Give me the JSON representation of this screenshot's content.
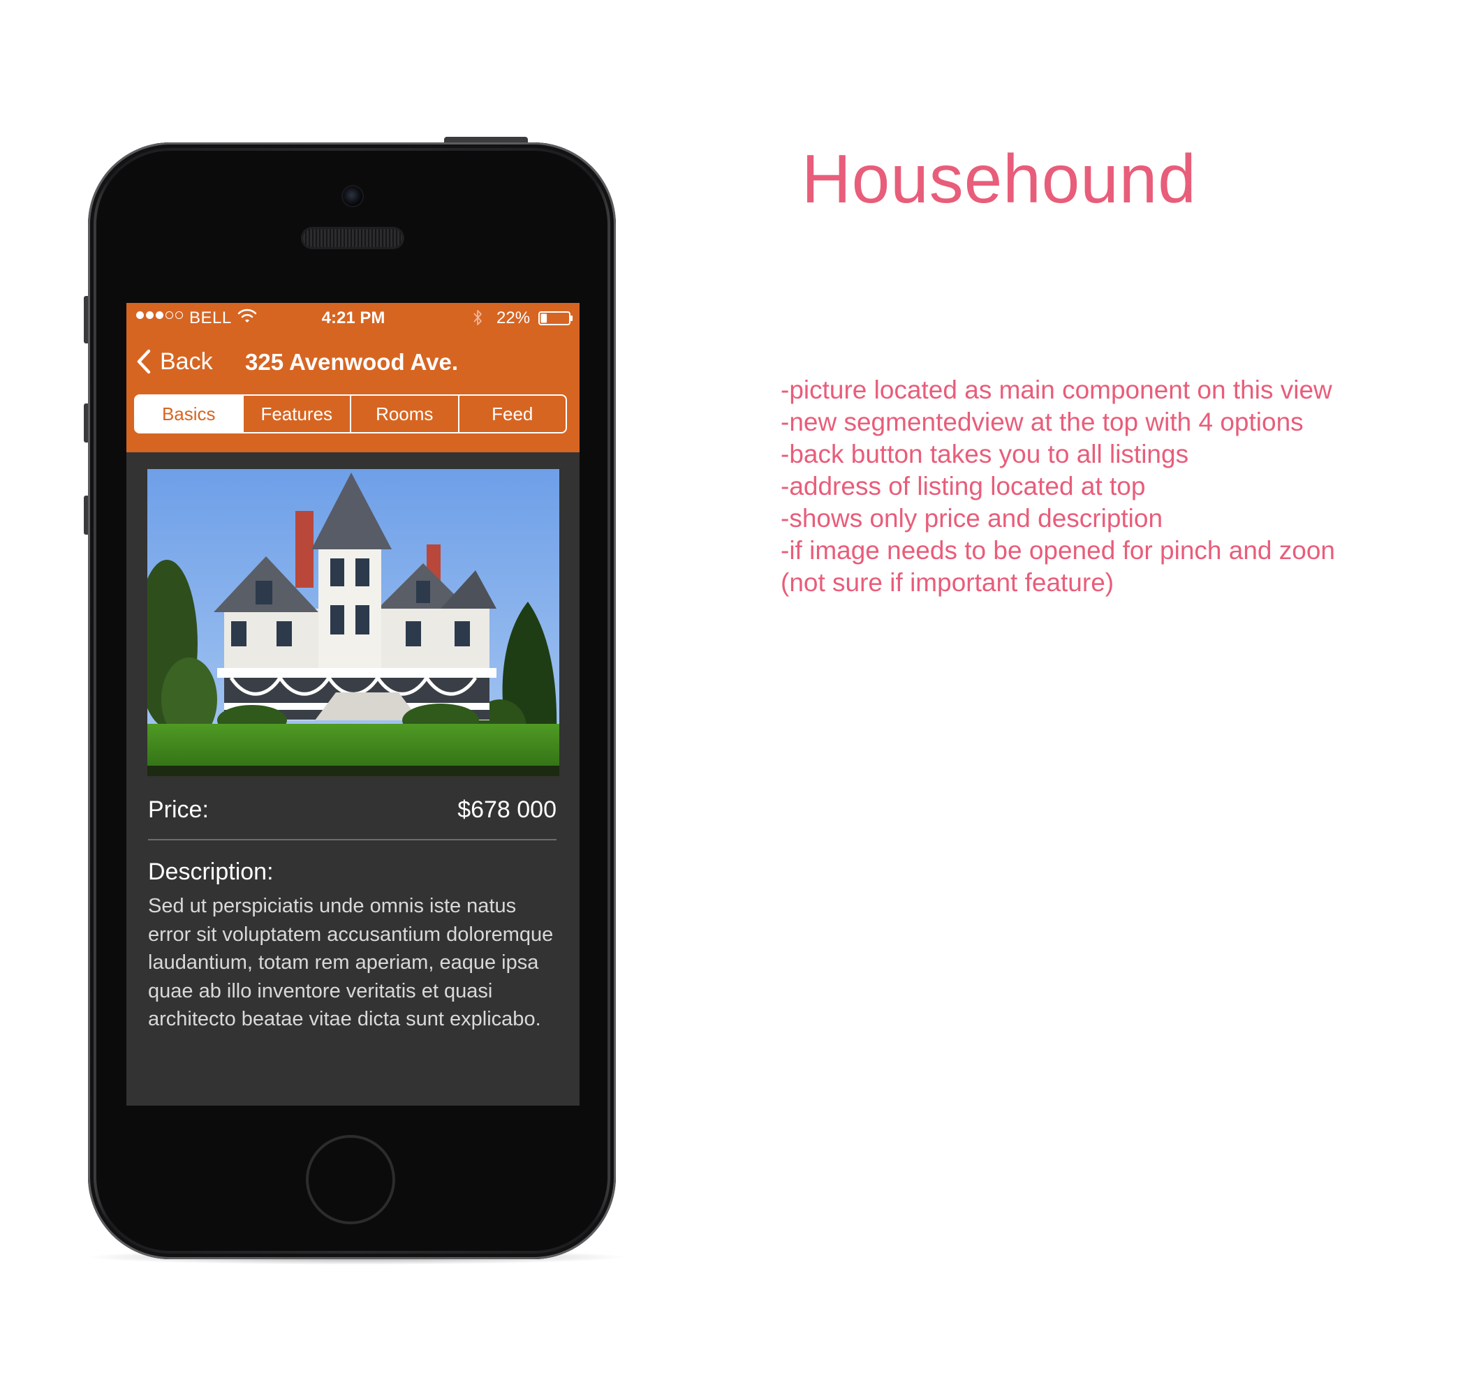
{
  "annotations": {
    "title": "Househound",
    "notes": [
      "-picture located as main component on this view",
      "-new segmentedview at the top with 4 options",
      "-back button takes you to all listings",
      "-address of listing located at top",
      "-shows only price and description",
      "-if image needs to be opened for pinch and zoon (not sure if important feature)"
    ]
  },
  "status_bar": {
    "signal_bars": 3,
    "signal_total": 5,
    "carrier": "BELL",
    "time": "4:21 PM",
    "battery": "22%",
    "battery_level": 0.22,
    "icons": [
      "wifi-icon",
      "bluetooth-icon",
      "battery-icon"
    ]
  },
  "nav": {
    "back_label": "Back",
    "title": "325 Avenwood Ave."
  },
  "segments": {
    "items": [
      "Basics",
      "Features",
      "Rooms",
      "Feed"
    ],
    "selected": "Basics"
  },
  "listing": {
    "photo": "house-photo",
    "price_label": "Price:",
    "price_value": "$678 000",
    "description_label": "Description:",
    "description": "Sed ut perspiciatis unde omnis iste natus error sit voluptatem accusantium doloremque laudantium, totam rem aperiam, eaque ipsa quae ab illo inventore veritatis et quasi architecto beatae vitae dicta sunt explicabo."
  },
  "colors": {
    "accent_orange": "#d66522",
    "screen_background": "#333333",
    "annotation_pink": "#e85d7a"
  }
}
